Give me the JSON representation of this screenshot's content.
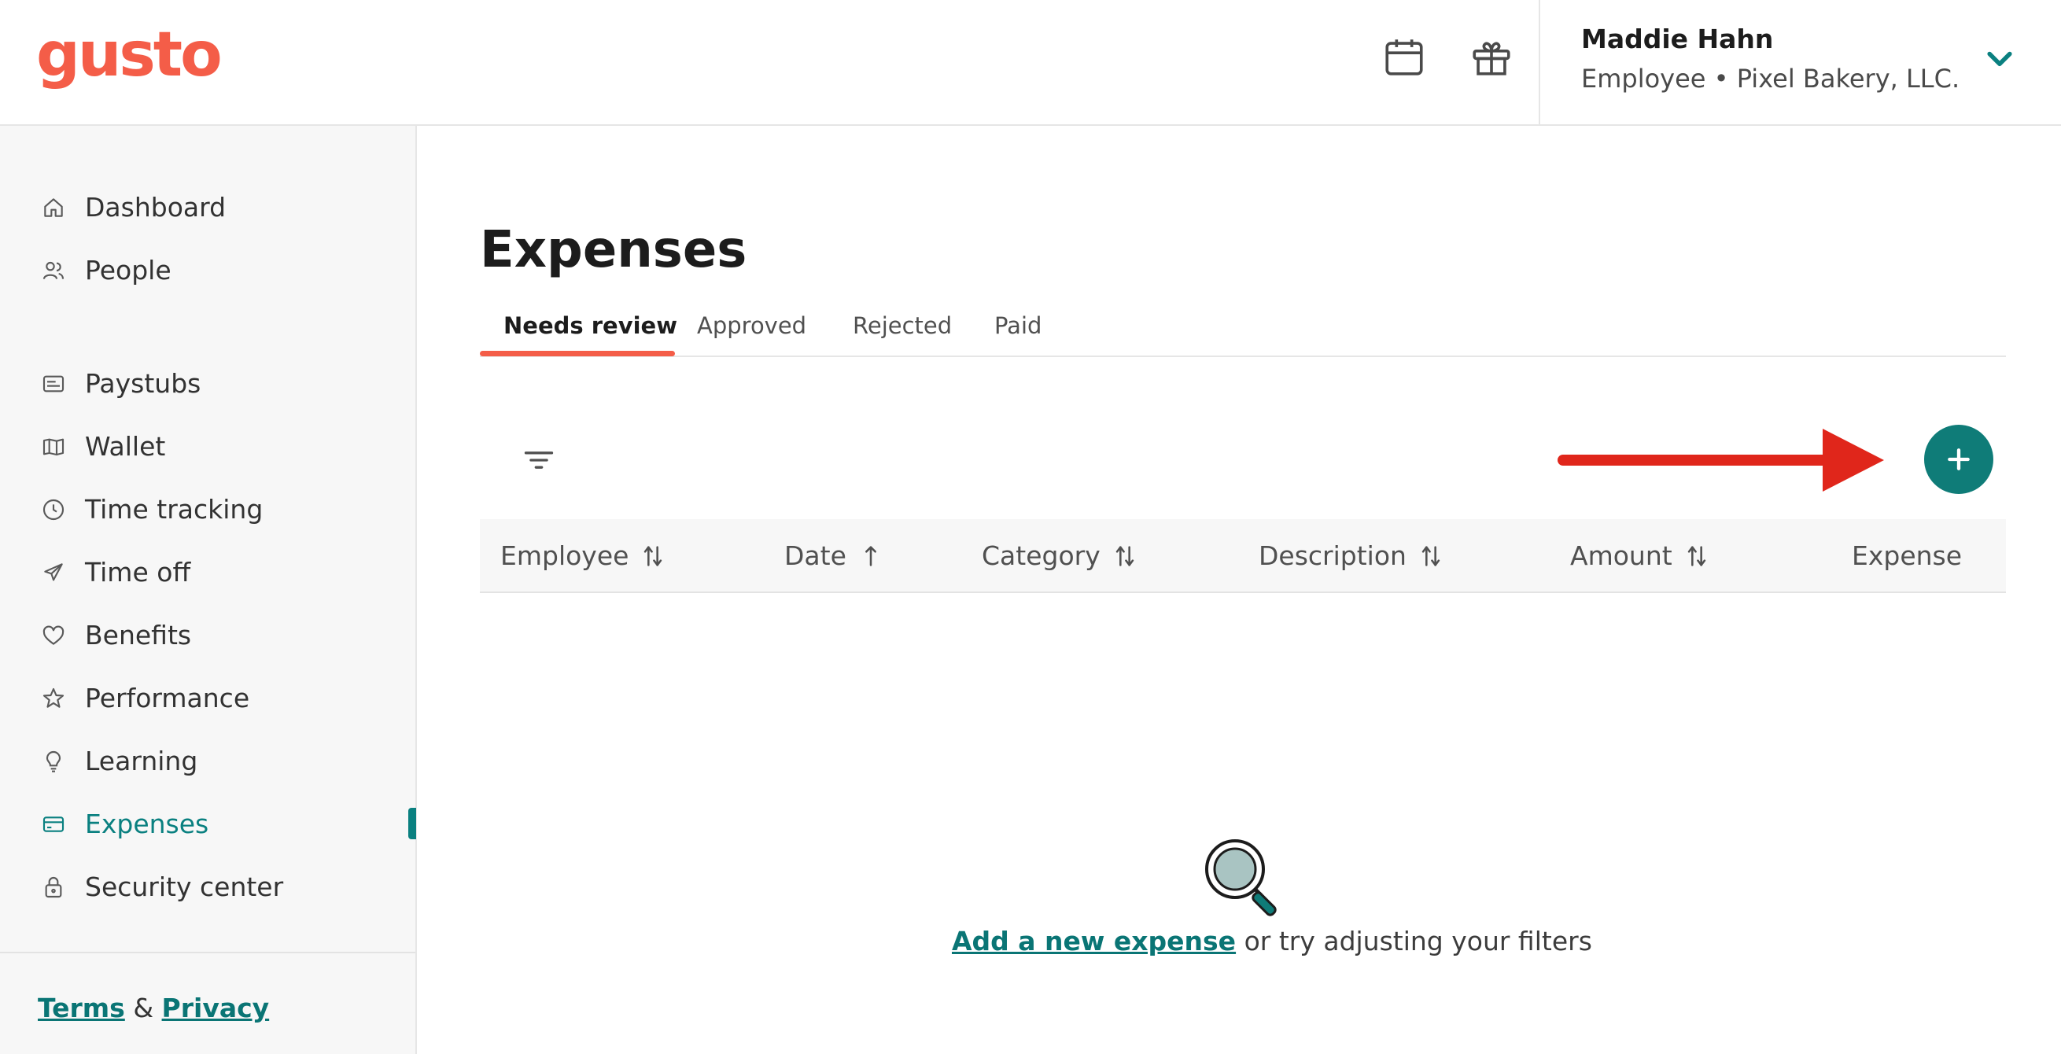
{
  "brand": {
    "logo_text": "gusto",
    "logo_color": "#f45d48"
  },
  "header": {
    "calendar_icon": "calendar-icon",
    "gift_icon": "gift-icon",
    "user": {
      "name": "Maddie Hahn",
      "subtitle": "Employee • Pixel Bakery, LLC."
    },
    "chevron_color": "#0a8080"
  },
  "sidebar": {
    "items": [
      {
        "label": "Dashboard",
        "icon": "home-icon"
      },
      {
        "label": "People",
        "icon": "people-icon"
      },
      {
        "label": "Paystubs",
        "icon": "paystub-icon"
      },
      {
        "label": "Wallet",
        "icon": "wallet-icon"
      },
      {
        "label": "Time tracking",
        "icon": "clock-icon"
      },
      {
        "label": "Time off",
        "icon": "plane-icon"
      },
      {
        "label": "Benefits",
        "icon": "heart-icon"
      },
      {
        "label": "Performance",
        "icon": "star-icon"
      },
      {
        "label": "Learning",
        "icon": "lightbulb-icon"
      },
      {
        "label": "Expenses",
        "icon": "card-icon",
        "active": true
      },
      {
        "label": "Security center",
        "icon": "lock-icon"
      }
    ],
    "footer": {
      "terms": "Terms",
      "separator": "&",
      "privacy": "Privacy"
    }
  },
  "main": {
    "title": "Expenses",
    "tabs": [
      {
        "label": "Needs review",
        "active": true
      },
      {
        "label": "Approved"
      },
      {
        "label": "Rejected"
      },
      {
        "label": "Paid"
      }
    ],
    "table": {
      "columns": [
        {
          "label": "Employee",
          "sort": "both"
        },
        {
          "label": "Date",
          "sort": "asc"
        },
        {
          "label": "Category",
          "sort": "both"
        },
        {
          "label": "Description",
          "sort": "both"
        },
        {
          "label": "Amount",
          "sort": "both"
        },
        {
          "label": "Expense",
          "sort": "none"
        }
      ],
      "rows": []
    },
    "empty_state": {
      "link_text": "Add a new expense",
      "rest_text": " or try adjusting your filters"
    }
  },
  "colors": {
    "accent": "#0a8080",
    "primary_button": "#0f7c78",
    "tab_indicator": "#f45d48",
    "annotation_arrow": "#e0261b"
  }
}
